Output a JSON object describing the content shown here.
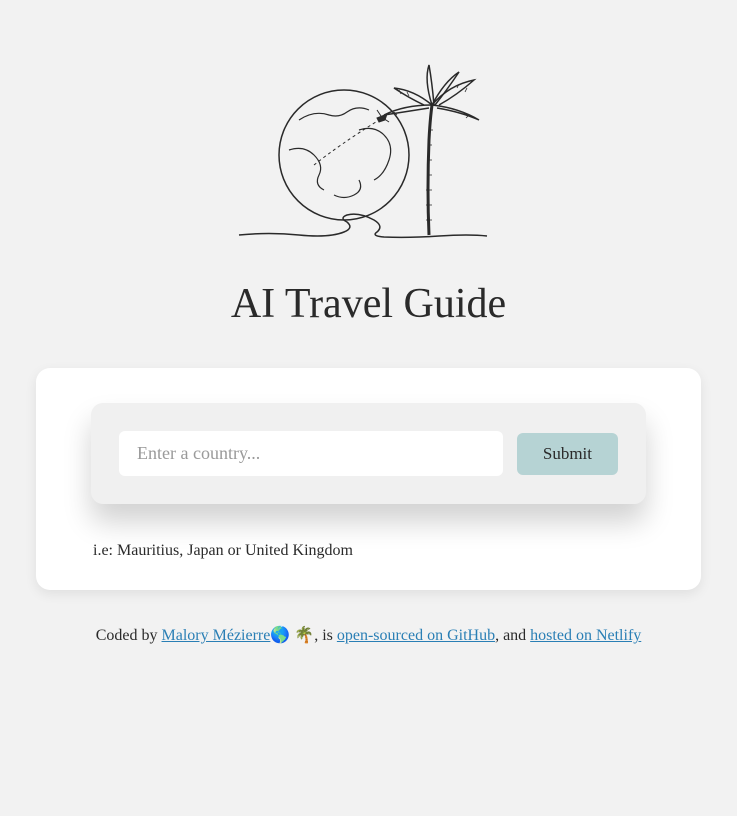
{
  "header": {
    "title": "AI Travel Guide"
  },
  "search": {
    "placeholder": "Enter a country...",
    "submit_label": "Submit",
    "hint": "i.e: Mauritius, Japan or United Kingdom"
  },
  "footer": {
    "prefix": "Coded by ",
    "author": "Malory Mézierre",
    "emojis": "🌎 🌴",
    "mid1": ", is ",
    "github_label": "open-sourced on GitHub",
    "mid2": ", and ",
    "netlify_label": "hosted on Netlify"
  }
}
